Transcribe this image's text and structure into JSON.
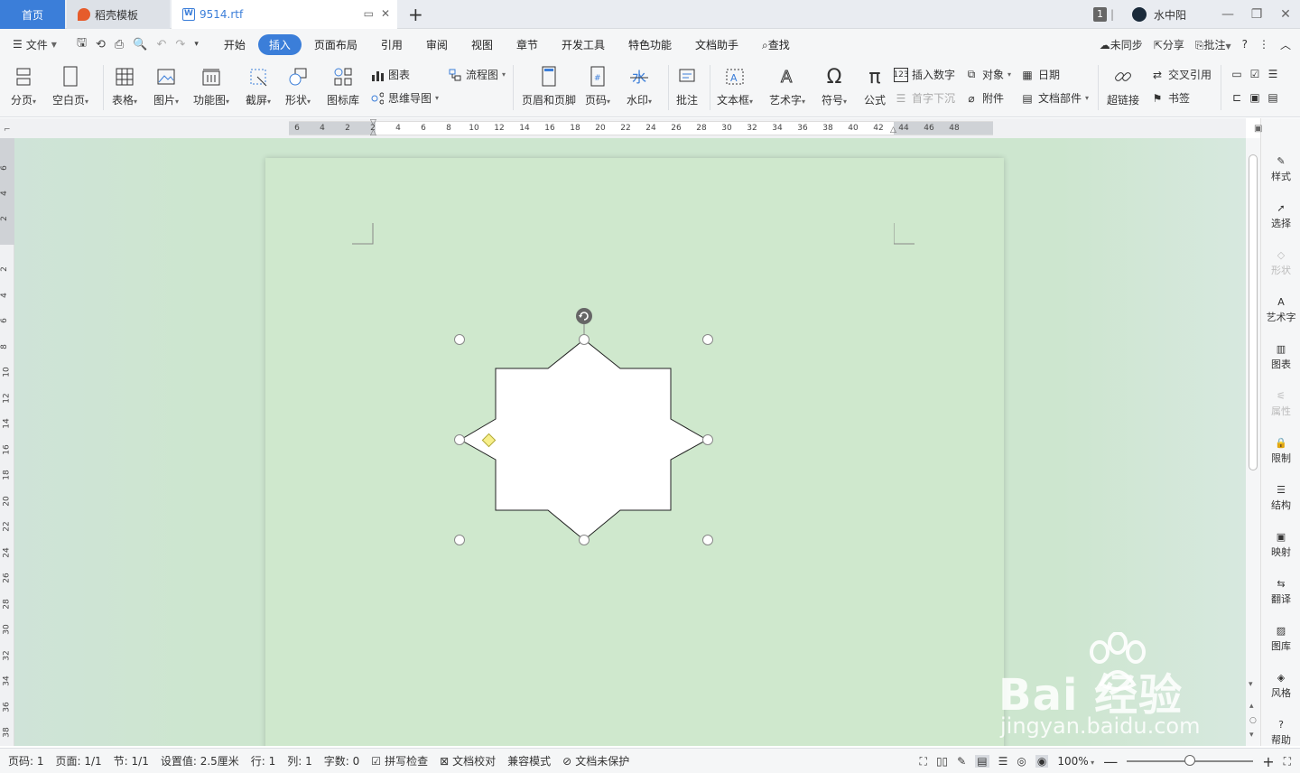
{
  "tabs": {
    "home": "首页",
    "daoke": "稻壳模板",
    "doc": "9514.rtf",
    "new": "+"
  },
  "window": {
    "count_badge": "1",
    "user_name": "水中阳"
  },
  "menu": {
    "file": "文件",
    "items": [
      "开始",
      "插入",
      "页面布局",
      "引用",
      "审阅",
      "视图",
      "章节",
      "开发工具",
      "特色功能",
      "文档助手"
    ],
    "search": "查找",
    "sync": "未同步",
    "share": "分享",
    "annotate": "批注",
    "help": "?"
  },
  "ribbon": {
    "page_break": "分页",
    "blank_page": "空白页",
    "table": "表格",
    "picture": "图片",
    "function_chart": "功能图",
    "screenshot": "截屏",
    "shape": "形状",
    "icon_lib": "图标库",
    "chart": "图表",
    "mindmap": "思维导图",
    "flowchart": "流程图",
    "header_footer": "页眉和页脚",
    "page_num": "页码",
    "watermark": "水印",
    "comment": "批注",
    "textbox": "文本框",
    "wordart": "艺术字",
    "symbol": "符号",
    "formula": "公式",
    "insert_number": "插入数字",
    "drop_cap": "首字下沉",
    "object": "对象",
    "attachment": "附件",
    "date": "日期",
    "doc_parts": "文档部件",
    "hyperlink": "超链接",
    "cross_ref": "交叉引用",
    "bookmark": "书签"
  },
  "ruler": {
    "h_ticks": [
      "6",
      "4",
      "2",
      "2",
      "4",
      "6",
      "8",
      "10",
      "12",
      "14",
      "16",
      "18",
      "20",
      "22",
      "24",
      "26",
      "28",
      "30",
      "32",
      "34",
      "36",
      "38",
      "40",
      "42",
      "44",
      "46",
      "48"
    ],
    "v_ticks": [
      "6",
      "4",
      "2",
      "2",
      "4",
      "6",
      "8",
      "10",
      "12",
      "14",
      "16",
      "18",
      "20",
      "22",
      "24",
      "26",
      "28",
      "30",
      "32",
      "34",
      "36",
      "38"
    ]
  },
  "sidebar": [
    {
      "label": "样式",
      "icon": "brush-icon",
      "enabled": true
    },
    {
      "label": "选择",
      "icon": "cursor-icon",
      "enabled": true
    },
    {
      "label": "形状",
      "icon": "shape-icon",
      "enabled": false
    },
    {
      "label": "艺术字",
      "icon": "wordart-icon",
      "enabled": true
    },
    {
      "label": "图表",
      "icon": "chart-icon",
      "enabled": true
    },
    {
      "label": "属性",
      "icon": "sliders-icon",
      "enabled": false
    },
    {
      "label": "限制",
      "icon": "lock-icon",
      "enabled": true
    },
    {
      "label": "结构",
      "icon": "structure-icon",
      "enabled": true
    },
    {
      "label": "映射",
      "icon": "map-icon",
      "enabled": true
    },
    {
      "label": "翻译",
      "icon": "translate-icon",
      "enabled": true
    },
    {
      "label": "图库",
      "icon": "gallery-icon",
      "enabled": true
    },
    {
      "label": "风格",
      "icon": "style-icon",
      "enabled": true
    },
    {
      "label": "帮助",
      "icon": "help-icon",
      "enabled": true
    }
  ],
  "status": {
    "page_code": "页码: 1",
    "page": "页面: 1/1",
    "section": "节: 1/1",
    "setting": "设置值: 2.5厘米",
    "row": "行: 1",
    "col": "列: 1",
    "word_count": "字数: 0",
    "spell_check": "拼写检查",
    "proofread": "文档校对",
    "compat": "兼容模式",
    "protect": "文档未保护",
    "zoom": "100%"
  },
  "watermark": {
    "main": "Bai  经验",
    "sub": "jingyan.baidu.com"
  },
  "colors": {
    "accent": "#3b7ed9",
    "page_bg": "#cfe8cd",
    "adjust_handle": "#f7ef8a"
  }
}
